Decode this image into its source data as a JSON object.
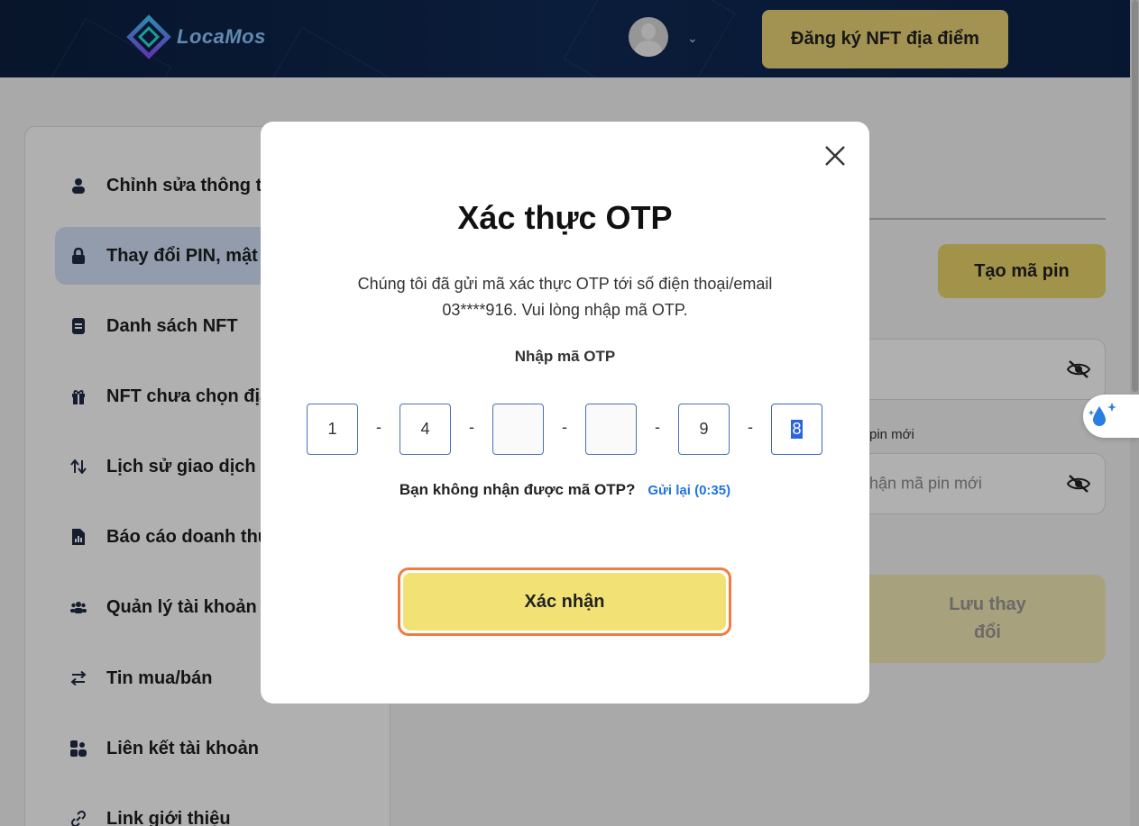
{
  "header": {
    "logo_text": "LocaMos",
    "register_nft_label": "Đăng ký NFT địa điểm"
  },
  "sidebar": {
    "items": [
      {
        "label": "Chỉnh sửa thông ti",
        "icon": "user-icon"
      },
      {
        "label": "Thay đổi PIN, mật",
        "icon": "lock-icon",
        "active": true
      },
      {
        "label": "Danh sách NFT",
        "icon": "document-icon"
      },
      {
        "label": "NFT chưa chọn địa",
        "icon": "gift-icon"
      },
      {
        "label": "Lịch sử giao dịch",
        "icon": "swap-vertical-icon"
      },
      {
        "label": "Báo cáo doanh thu",
        "icon": "report-file-icon"
      },
      {
        "label": "Quản lý tài khoản",
        "icon": "users-icon"
      },
      {
        "label": "Tin mua/bán",
        "icon": "swap-horizontal-icon"
      },
      {
        "label": "Liên kết tài khoản",
        "icon": "linked-accounts-icon"
      },
      {
        "label": "Link giới thiệu",
        "icon": "link-icon"
      }
    ]
  },
  "main": {
    "create_pin_label": "Tạo mã pin",
    "new_pin_label": "pin mới",
    "confirm_pin_placeholder": "hận mã pin mới",
    "save_label_line1": "Lưu thay",
    "save_label_line2": "đổi"
  },
  "modal": {
    "title": "Xác thực OTP",
    "description_line1": "Chúng tôi đã gửi mã xác thực OTP tới số điện thoại/email",
    "description_line2": "03****916. Vui lòng nhập mã OTP.",
    "otp_label": "Nhập mã OTP",
    "otp_digits": [
      "1",
      "4",
      "",
      "",
      "9",
      "8"
    ],
    "separator": "-",
    "resend_question": "Bạn không nhận được mã OTP?",
    "resend_link": "Gửi lại (0:35)",
    "confirm_label": "Xác nhận"
  },
  "colors": {
    "header_bg": "#0f2a55",
    "accent_yellow": "#f2e275",
    "sidebar_active": "#d4e3fb",
    "link_blue": "#1f74e0",
    "confirm_outline": "#f07d40"
  }
}
